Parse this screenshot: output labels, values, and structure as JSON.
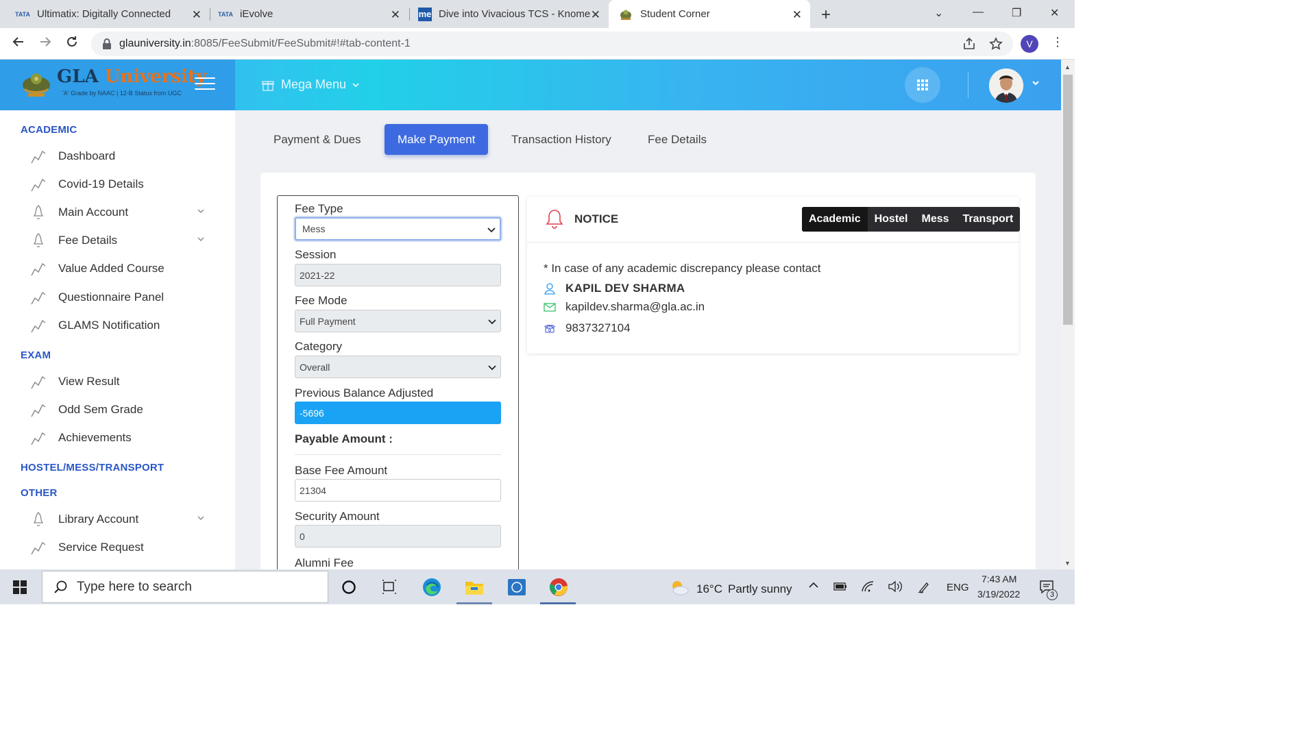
{
  "browser": {
    "tabs": [
      {
        "title": "Ultimatix: Digitally Connected",
        "favicon": "tata-icon"
      },
      {
        "title": "iEvolve",
        "favicon": "tata-icon"
      },
      {
        "title": "Dive into Vivacious TCS - Knome",
        "favicon": "knome-icon"
      },
      {
        "title": "Student Corner",
        "favicon": "gla-icon",
        "active": true
      }
    ],
    "favicon_tata_text": "TATA",
    "favicon_knome_text": "me",
    "new_tab": "+",
    "url_domain": "glauniversity.in",
    "url_path": ":8085/FeeSubmit/FeeSubmit#!#tab-content-1",
    "profile_letter": "V"
  },
  "header": {
    "logo_name_1": "GLA",
    "logo_name_2": "University",
    "logo_sub": "'A' Grade by NAAC | 12-B Status from UGC",
    "mega_menu": "Mega Menu"
  },
  "sidebar": {
    "sections": {
      "academic": "ACADEMIC",
      "exam": "EXAM",
      "hostel": "HOSTEL/MESS/TRANSPORT",
      "other": "OTHER"
    },
    "academic_items": [
      "Dashboard",
      "Covid-19 Details",
      "Main Account",
      "Fee Details",
      "Value Added Course",
      "Questionnaire Panel",
      "GLAMS Notification"
    ],
    "exam_items": [
      "View Result",
      "Odd Sem Grade",
      "Achievements"
    ],
    "other_items": [
      "Library Account",
      "Service Request"
    ]
  },
  "tabs": [
    "Payment & Dues",
    "Make Payment",
    "Transaction History",
    "Fee Details"
  ],
  "active_tab": "Make Payment",
  "form": {
    "fee_type_label": "Fee Type",
    "fee_type_value": "Mess",
    "session_label": "Session",
    "session_value": "2021-22",
    "fee_mode_label": "Fee Mode",
    "fee_mode_value": "Full Payment",
    "category_label": "Category",
    "category_value": "Overall",
    "prev_balance_label": "Previous Balance Adjusted",
    "prev_balance_value": "-5696",
    "payable_label": "Payable Amount :",
    "base_fee_label": "Base Fee Amount",
    "base_fee_value": "21304",
    "security_label": "Security Amount",
    "security_value": "0",
    "alumni_label": "Alumni Fee"
  },
  "notice": {
    "title": "NOTICE",
    "buttons": [
      "Academic",
      "Hostel",
      "Mess",
      "Transport"
    ],
    "active_button": "Academic",
    "text": "* In case of any academic discrepancy please contact",
    "contact_name": "KAPIL DEV SHARMA",
    "contact_email": "kapildev.sharma@gla.ac.in",
    "contact_phone": "9837327104"
  },
  "taskbar": {
    "search_placeholder": "Type here to search",
    "weather_temp": "16°C",
    "weather_text": "Partly sunny",
    "lang": "ENG",
    "time": "7:43 AM",
    "date": "3/19/2022",
    "notification_count": "3"
  },
  "colors": {
    "header_gradient": [
      "#3aa0ee",
      "#22d0e8",
      "#3aa0ef"
    ],
    "primary_button": "#3d6ae0",
    "section_title": "#2a56c6",
    "highlight_input": "#1aa3f5",
    "bell": "#e0424c"
  }
}
